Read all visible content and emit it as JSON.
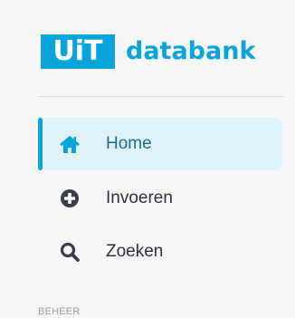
{
  "logo": {
    "badge_text": "UiT",
    "word_text": "databank"
  },
  "nav": {
    "items": [
      {
        "label": "Home",
        "icon": "home-icon",
        "active": true
      },
      {
        "label": "Invoeren",
        "icon": "plus-circle-icon",
        "active": false
      },
      {
        "label": "Zoeken",
        "icon": "search-icon",
        "active": false
      }
    ]
  },
  "sections": {
    "beheer_label": "BEHEER"
  },
  "colors": {
    "brand": "#0aa4dc",
    "active_bg": "#dff1f9",
    "text": "#2b3440",
    "icon_dark": "#3a3f47"
  }
}
